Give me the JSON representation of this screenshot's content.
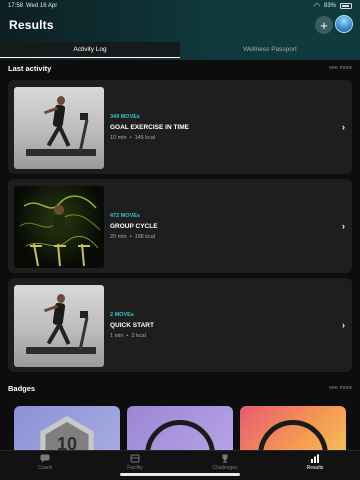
{
  "status_bar": {
    "time": "17:58",
    "date": "Wed 16 Apr",
    "battery": "83%"
  },
  "header": {
    "title": "Results"
  },
  "tabs": [
    {
      "label": "Activity Log",
      "active": true
    },
    {
      "label": "Wellness Passport",
      "active": false
    }
  ],
  "last_activity": {
    "heading": "Last activity",
    "see_more": "see more",
    "items": [
      {
        "moves": "349 MOVEs",
        "name": "GOAL EXERCISE IN TIME",
        "duration": "10 min",
        "kcal": "145 kcal",
        "image": "treadmill-runner"
      },
      {
        "moves": "472 MOVEs",
        "name": "GROUP CYCLE",
        "duration": "20 min",
        "kcal": "198 kcal",
        "image": "group-cycle"
      },
      {
        "moves": "2 MOVEs",
        "name": "QUICK START",
        "duration": "1 min",
        "kcal": "2 kcal",
        "image": "treadmill-runner"
      }
    ]
  },
  "badges": {
    "heading": "Badges",
    "see_more": "see more",
    "first_badge_number": "10"
  },
  "nav": [
    {
      "label": "Coach",
      "icon": "chat-icon",
      "active": false
    },
    {
      "label": "Facility",
      "icon": "facility-icon",
      "active": false
    },
    {
      "label": "Challenges",
      "icon": "trophy-icon",
      "active": false
    },
    {
      "label": "Results",
      "icon": "bar-chart-icon",
      "active": true
    }
  ],
  "colors": {
    "accent": "#2fc8c8",
    "header_bg": "#10393d",
    "card_bg": "#1e1e1e"
  }
}
